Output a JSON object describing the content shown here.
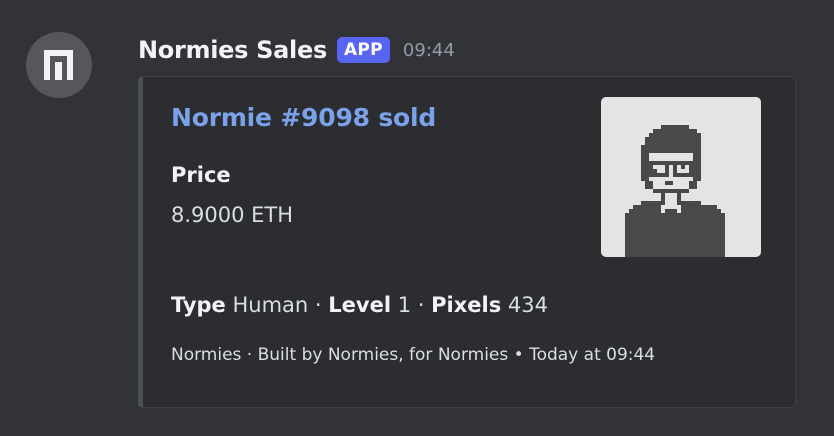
{
  "author": {
    "username": "Normies Sales",
    "badge": "APP",
    "timestamp": "09:44"
  },
  "embed": {
    "title": "Normie #9098 sold",
    "fields": [
      {
        "name": "Price",
        "value": "8.9000 ETH"
      }
    ],
    "description": {
      "type_label": "Type",
      "type_value": "Human",
      "sep1": " · ",
      "level_label": "Level",
      "level_value": "1",
      "sep2": " · ",
      "pixels_label": "Pixels",
      "pixels_value": "434"
    },
    "footer": {
      "text": "Normies · Built by Normies, for Normies",
      "separator": "•",
      "time": "Today at 09:44"
    },
    "colors": {
      "title_link": "#7ba2e8",
      "accent_bar": "#4e5058",
      "badge": "#5865f2"
    },
    "icons": {
      "avatar": "normies-logo-icon",
      "thumbnail": "pixel-portrait-image"
    }
  }
}
